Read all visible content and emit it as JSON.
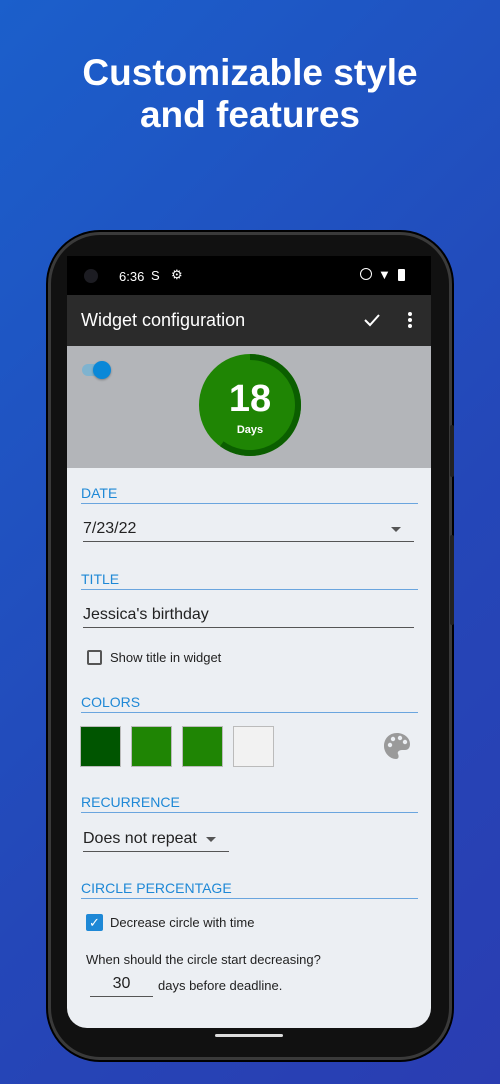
{
  "headline": {
    "line1": "Customizable style",
    "line2": "and features"
  },
  "status_bar": {
    "time": "6:36"
  },
  "app_bar": {
    "title": "Widget configuration",
    "confirm_icon": "check-icon",
    "menu_icon": "more-vert-icon"
  },
  "preview": {
    "toggle_on": true,
    "days_number": "18",
    "days_label": "Days",
    "circle_fill_color": "#1f8504",
    "arc_color": "#0b5e00",
    "progress_fraction": 0.6
  },
  "date": {
    "header": "DATE",
    "value": "7/23/22"
  },
  "title": {
    "header": "TITLE",
    "value": "Jessica's birthday",
    "show_title_label": "Show title in widget",
    "show_title_checked": false
  },
  "colors": {
    "header": "COLORS",
    "swatches": [
      "#005500",
      "#1f8504",
      "#1f8504",
      "#f2f2f2"
    ]
  },
  "recurrence": {
    "header": "RECURRENCE",
    "value": "Does not repeat"
  },
  "circle_percentage": {
    "header": "CIRCLE PERCENTAGE",
    "decrease_label": "Decrease circle with time",
    "decrease_checked": true,
    "question": "When should the circle start decreasing?",
    "days_value": "30",
    "days_suffix": "days before deadline."
  }
}
